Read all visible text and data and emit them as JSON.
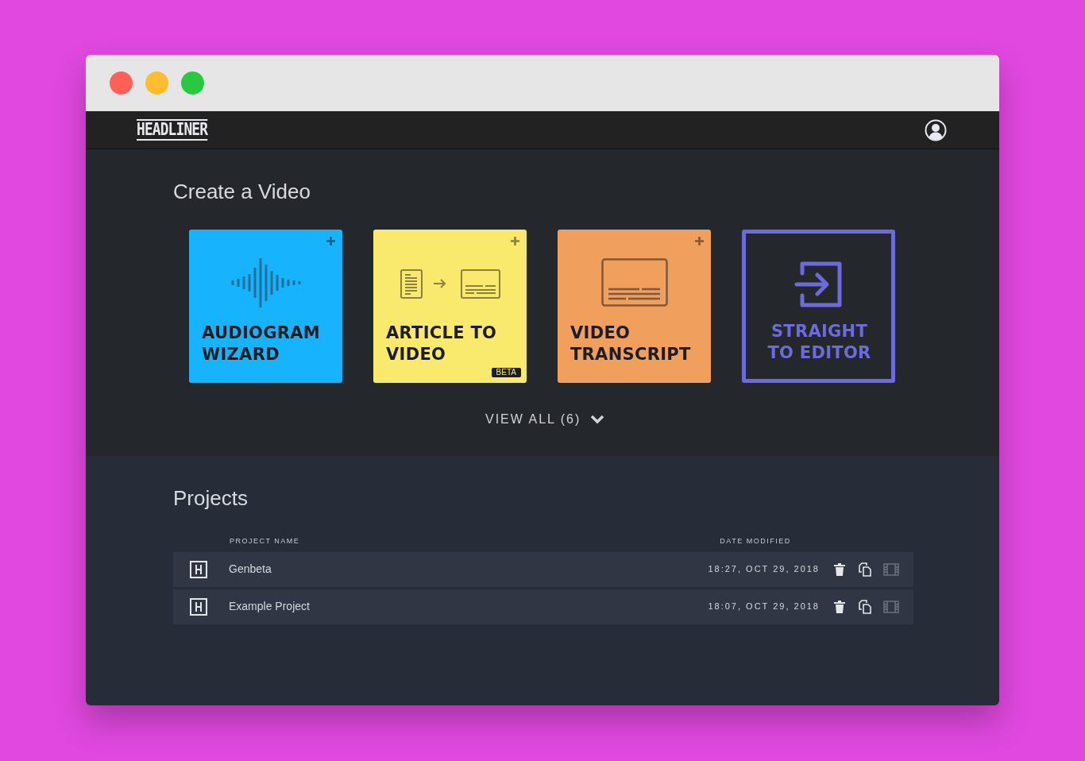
{
  "window": {
    "controls": [
      {
        "color": "#fe5f57"
      },
      {
        "color": "#febc2e"
      },
      {
        "color": "#28c840"
      }
    ]
  },
  "navbar": {
    "logo": "HEADLINER"
  },
  "create": {
    "title": "Create a Video",
    "cards": [
      {
        "kind": "filled",
        "label": [
          "AUDIOGRAM",
          "WIZARD"
        ],
        "color": "#17b4fd"
      },
      {
        "kind": "filled",
        "label": [
          "ARTICLE TO",
          "VIDEO"
        ],
        "color": "#f9e96c",
        "badge": "BETA"
      },
      {
        "kind": "filled",
        "label": [
          "VIDEO",
          "TRANSCRIPT"
        ],
        "color": "#f19f5c"
      },
      {
        "kind": "outlined",
        "label": [
          "STRAIGHT",
          "TO EDITOR"
        ],
        "color": "#6c6bdd"
      }
    ],
    "view_all": "VIEW ALL (6)"
  },
  "projects": {
    "title": "Projects",
    "columns": [
      "PROJECT NAME",
      "DATE MODIFIED"
    ],
    "rows": [
      {
        "name": "Genbeta",
        "date": "18:27, OCT 29, 2018"
      },
      {
        "name": "Example Project",
        "date": "18:07, OCT 29, 2018"
      }
    ]
  }
}
